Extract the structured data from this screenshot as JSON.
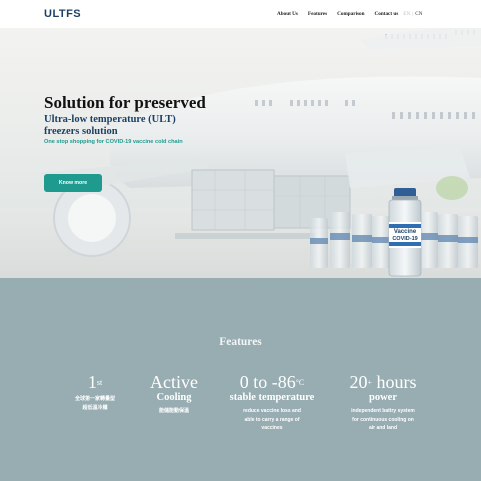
{
  "header": {
    "logo": "ULTFS",
    "nav": {
      "about": "About Us",
      "features": "Features",
      "comparison": "Comparison",
      "contact": "Contact us",
      "lang_en": "EN",
      "lang_sep": "|",
      "lang_cn": "CN"
    }
  },
  "hero": {
    "title": "Solution for preserved",
    "subtitle_line1": "Ultra-low temperature (ULT)",
    "subtitle_line2": "freezers solution",
    "tagline": "One stop shopping for COVID-19 vaccine cold chain",
    "button_label": "Know more",
    "vial_label_top": "Vaccine",
    "vial_label_bottom": "COVID-19",
    "colors": {
      "accent": "#1f9a8f",
      "brand": "#1d3f66"
    }
  },
  "features": {
    "title": "Features",
    "background": "#97adb2",
    "items": [
      {
        "big": "1",
        "sup": "st",
        "mid": "",
        "desc_line1": "全球第一家轉量型",
        "desc_line2": "超低溫冷櫃",
        "desc_line3": ""
      },
      {
        "big": "Active",
        "sup": "",
        "mid": "Cooling",
        "desc_line1": "能儲能動保溫",
        "desc_line2": "",
        "desc_line3": ""
      },
      {
        "big": "0 to -86",
        "sup": "°C",
        "mid": "stable temperature",
        "desc_line1": "reduce vaccine loss and",
        "desc_line2": "able to carry a range of",
        "desc_line3": "vaccines"
      },
      {
        "big": "20",
        "sup": "+",
        "big_suffix": " hours",
        "mid": "power",
        "desc_line1": "independent battry system",
        "desc_line2": "for continuous cooling on",
        "desc_line3": "air and land"
      }
    ]
  }
}
